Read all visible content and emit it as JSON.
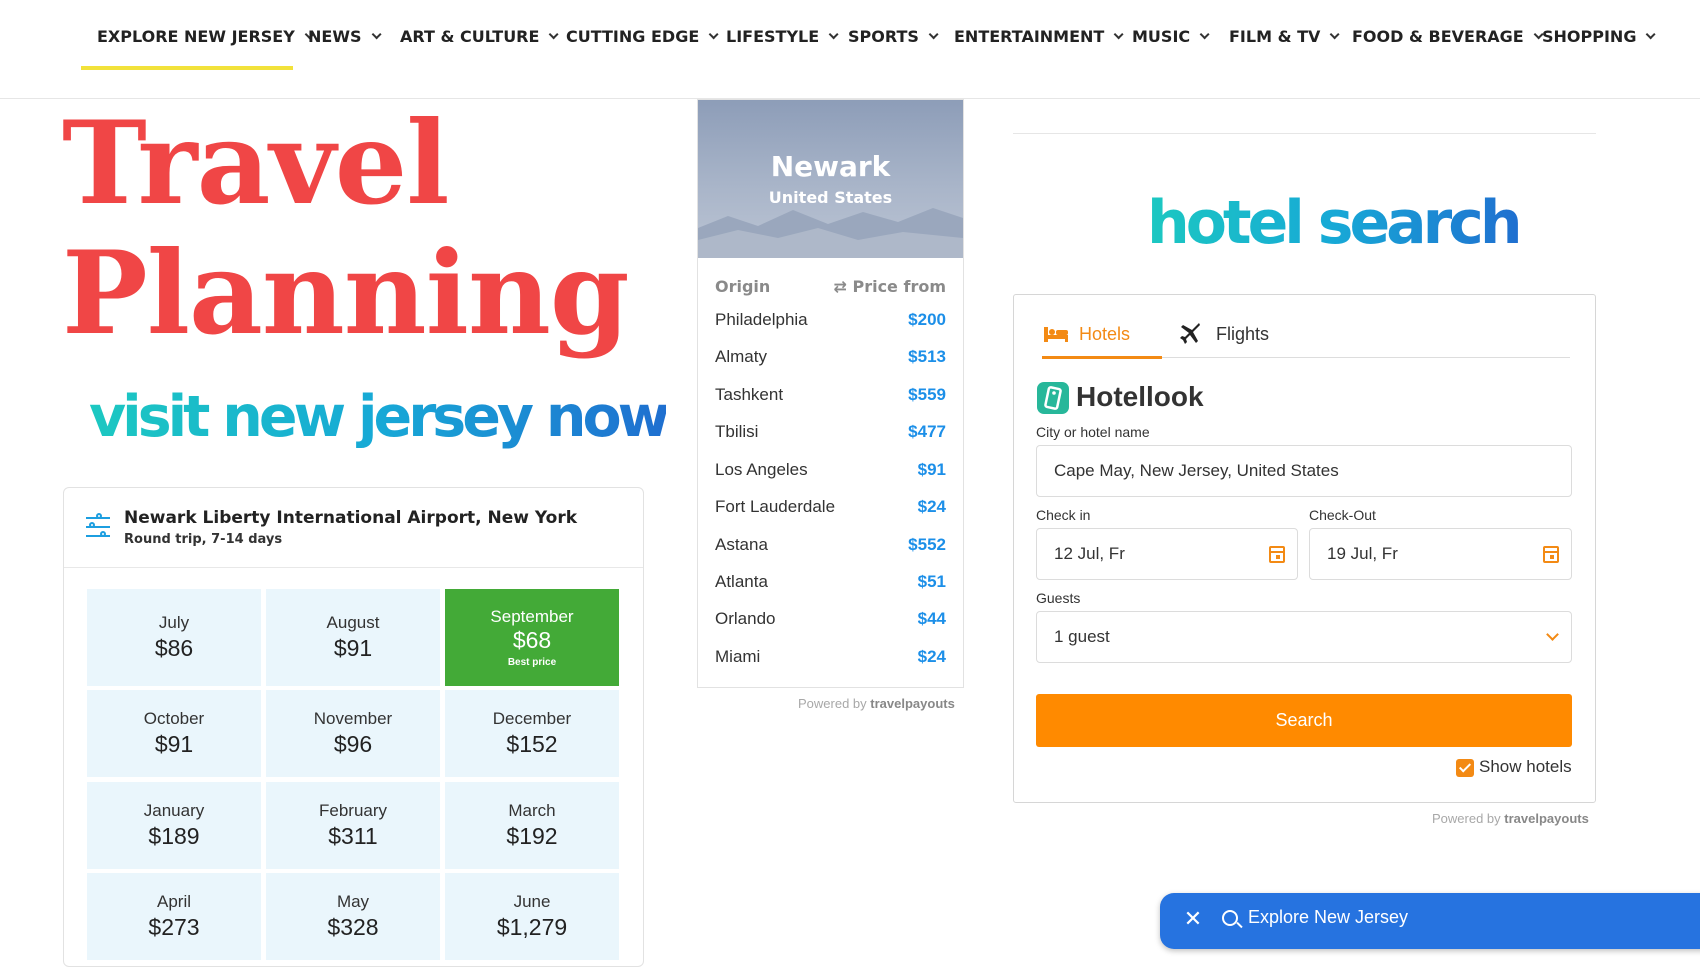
{
  "nav": {
    "items": [
      {
        "label": "EXPLORE NEW JERSEY",
        "active": true
      },
      {
        "label": "NEWS"
      },
      {
        "label": "ART & CULTURE"
      },
      {
        "label": "CUTTING EDGE"
      },
      {
        "label": "LIFESTYLE"
      },
      {
        "label": "SPORTS"
      },
      {
        "label": "ENTERTAINMENT"
      },
      {
        "label": "MUSIC"
      },
      {
        "label": "FILM & TV"
      },
      {
        "label": "FOOD & BEVERAGE"
      },
      {
        "label": "SHOPPING"
      }
    ]
  },
  "hero": {
    "title_line1": "Travel",
    "title_line2": "Planning",
    "subtitle": "visit new jersey now"
  },
  "calendar": {
    "title": "Newark Liberty International Airport, New York",
    "subtitle": "Round trip, 7-14 days",
    "months": [
      {
        "month": "July",
        "price": "$86"
      },
      {
        "month": "August",
        "price": "$91"
      },
      {
        "month": "September",
        "price": "$68",
        "badge": "Best price"
      },
      {
        "month": "October",
        "price": "$91"
      },
      {
        "month": "November",
        "price": "$96"
      },
      {
        "month": "December",
        "price": "$152"
      },
      {
        "month": "January",
        "price": "$189"
      },
      {
        "month": "February",
        "price": "$311"
      },
      {
        "month": "March",
        "price": "$192"
      },
      {
        "month": "April",
        "price": "$273"
      },
      {
        "month": "May",
        "price": "$328"
      },
      {
        "month": "June",
        "price": "$1,279"
      }
    ]
  },
  "destination": {
    "city": "Newark",
    "country": "United States",
    "col_origin": "Origin",
    "col_price": "Price from",
    "rows": [
      {
        "origin": "Philadelphia",
        "price": "$200"
      },
      {
        "origin": "Almaty",
        "price": "$513"
      },
      {
        "origin": "Tashkent",
        "price": "$559"
      },
      {
        "origin": "Tbilisi",
        "price": "$477"
      },
      {
        "origin": "Los Angeles",
        "price": "$91"
      },
      {
        "origin": "Fort Lauderdale",
        "price": "$24"
      },
      {
        "origin": "Astana",
        "price": "$552"
      },
      {
        "origin": "Atlanta",
        "price": "$51"
      },
      {
        "origin": "Orlando",
        "price": "$44"
      },
      {
        "origin": "Miami",
        "price": "$24"
      }
    ],
    "powered_prefix": "Powered by",
    "powered_brand": "travelpayouts"
  },
  "hotel": {
    "heading": "hotel search",
    "tab_hotels": "Hotels",
    "tab_flights": "Flights",
    "brand": "Hotellook",
    "city_label": "City or hotel name",
    "city_value": "Cape May, New Jersey, United States",
    "checkin_label": "Check in",
    "checkin_value": "12 Jul, Fr",
    "checkout_label": "Check-Out",
    "checkout_value": "19 Jul, Fr",
    "guests_label": "Guests",
    "guests_value": "1 guest",
    "search_label": "Search",
    "show_hotels_label": "Show hotels",
    "show_hotels_checked": true,
    "powered_prefix": "Powered by",
    "powered_brand": "travelpayouts",
    "accent_color": "#f38a14"
  },
  "search_pill": {
    "text": "Explore New Jersey",
    "close_icon": "close-icon",
    "search_icon": "search-icon"
  },
  "colors": {
    "title_red": "#f04646",
    "best_green": "#43aa37",
    "price_blue": "#1c8fe8",
    "pill_blue": "#2673e0"
  }
}
